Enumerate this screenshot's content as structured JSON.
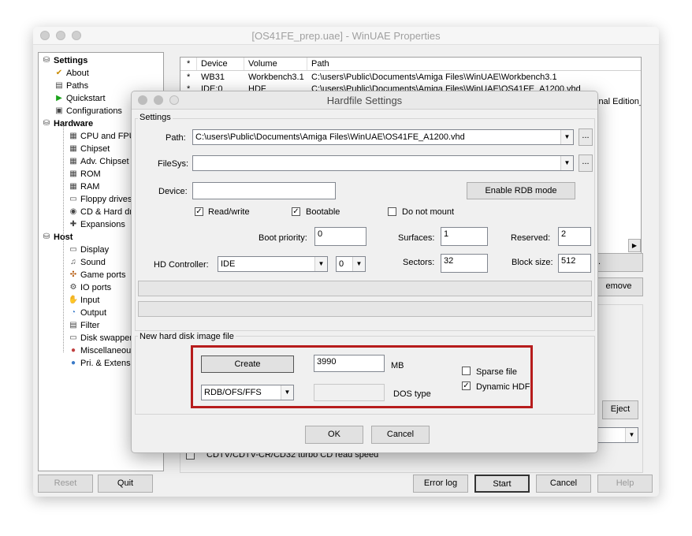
{
  "main_window": {
    "title": "[OS41FE_prep.uae] - WinUAE Properties",
    "tree": [
      {
        "label": "Settings",
        "icon": "settings-icon"
      },
      {
        "label": "About",
        "icon": "about-icon"
      },
      {
        "label": "Paths",
        "icon": "paths-icon"
      },
      {
        "label": "Quickstart",
        "icon": "quickstart-icon"
      },
      {
        "label": "Configurations",
        "icon": "configurations-icon"
      },
      {
        "label": "Hardware",
        "icon": "hardware-icon"
      },
      {
        "label": "CPU and FPU",
        "icon": "cpu-icon"
      },
      {
        "label": "Chipset",
        "icon": "chipset-icon"
      },
      {
        "label": "Adv. Chipset",
        "icon": "adv-chipset-icon"
      },
      {
        "label": "ROM",
        "icon": "rom-icon"
      },
      {
        "label": "RAM",
        "icon": "ram-icon"
      },
      {
        "label": "Floppy drives",
        "icon": "floppy-icon"
      },
      {
        "label": "CD & Hard drives",
        "icon": "cd-hard-drive-icon"
      },
      {
        "label": "Expansions",
        "icon": "expansions-icon"
      },
      {
        "label": "Host",
        "icon": "host-icon"
      },
      {
        "label": "Display",
        "icon": "display-icon"
      },
      {
        "label": "Sound",
        "icon": "sound-icon"
      },
      {
        "label": "Game ports",
        "icon": "game-ports-icon"
      },
      {
        "label": "IO ports",
        "icon": "io-ports-icon"
      },
      {
        "label": "Input",
        "icon": "input-icon"
      },
      {
        "label": "Output",
        "icon": "output-icon"
      },
      {
        "label": "Filter",
        "icon": "filter-icon"
      },
      {
        "label": "Disk swapper",
        "icon": "disk-swapper-icon"
      },
      {
        "label": "Miscellaneous",
        "icon": "miscellaneous-icon"
      },
      {
        "label": "Pri. & Extensions",
        "icon": "extensions-icon"
      }
    ],
    "table": {
      "headers": [
        "*",
        "Device",
        "Volume",
        "Path"
      ],
      "rows": [
        [
          "*",
          "WB31",
          "Workbench3.1",
          "C:\\users\\Public\\Documents\\Amiga Files\\WinUAE\\Workbench3.1"
        ],
        [
          "*",
          "IDE:0",
          "HDF",
          "C:\\users\\Public\\Documents\\Amiga Files\\WinUAE\\OS41FE_A1200.vhd"
        ]
      ],
      "overflow_text": "inal Edition_"
    },
    "remove_label": "emove",
    "add_partial_label": ".",
    "eject_label": "Eject",
    "cdtv_label": "CDTV/CDTV-CR/CD32 turbo CD read speed",
    "buttons": {
      "reset": "Reset",
      "quit": "Quit",
      "error_log": "Error log",
      "start": "Start",
      "cancel": "Cancel",
      "help": "Help"
    }
  },
  "dialog": {
    "title": "Hardfile Settings",
    "settings_group": "Settings",
    "path_label": "Path:",
    "path_value": "C:\\users\\Public\\Documents\\Amiga Files\\WinUAE\\OS41FE_A1200.vhd",
    "filesys_label": "FileSys:",
    "filesys_value": "",
    "device_label": "Device:",
    "device_value": "",
    "browse_label": "...",
    "enable_rdb": "Enable RDB mode",
    "read_write": "Read/write",
    "bootable": "Bootable",
    "do_not_mount": "Do not mount",
    "check_mark": "✓",
    "boot_priority_label": "Boot priority:",
    "boot_priority_value": "0",
    "surfaces_label": "Surfaces:",
    "surfaces_value": "1",
    "reserved_label": "Reserved:",
    "reserved_value": "2",
    "hd_controller_label": "HD Controller:",
    "hd_controller_value": "IDE",
    "hd_unit_value": "0",
    "sectors_label": "Sectors:",
    "sectors_value": "32",
    "block_size_label": "Block size:",
    "block_size_value": "512",
    "new_image_group": "New hard disk image file",
    "create_label": "Create",
    "size_value": "3990",
    "size_unit": "MB",
    "sparse_file": "Sparse file",
    "dynamic_hdf": "Dynamic HDF",
    "fs_type_value": "RDB/OFS/FFS",
    "dos_type_label": "DOS type",
    "ok_label": "OK",
    "cancel_label": "Cancel"
  }
}
